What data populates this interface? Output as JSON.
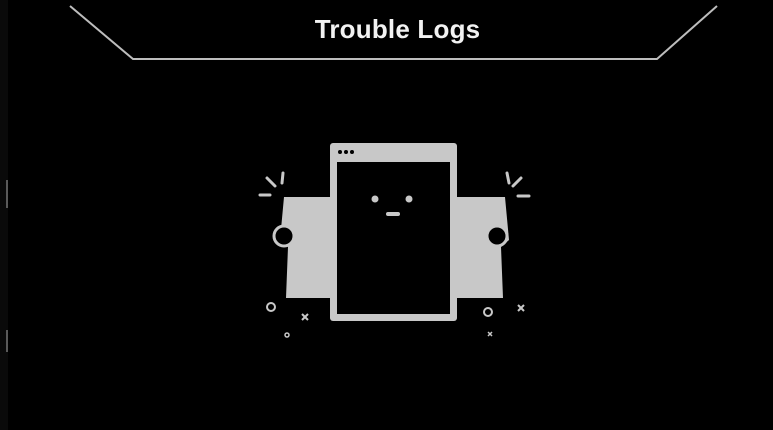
{
  "header": {
    "title": "Trouble Logs"
  },
  "empty_state": {
    "illustration": "broken-window-face-icon"
  },
  "colors": {
    "background": "#000000",
    "frame_line": "#bdbdbd",
    "title_text": "#f2f2f2",
    "illustration_fill": "#c8c8c8"
  }
}
